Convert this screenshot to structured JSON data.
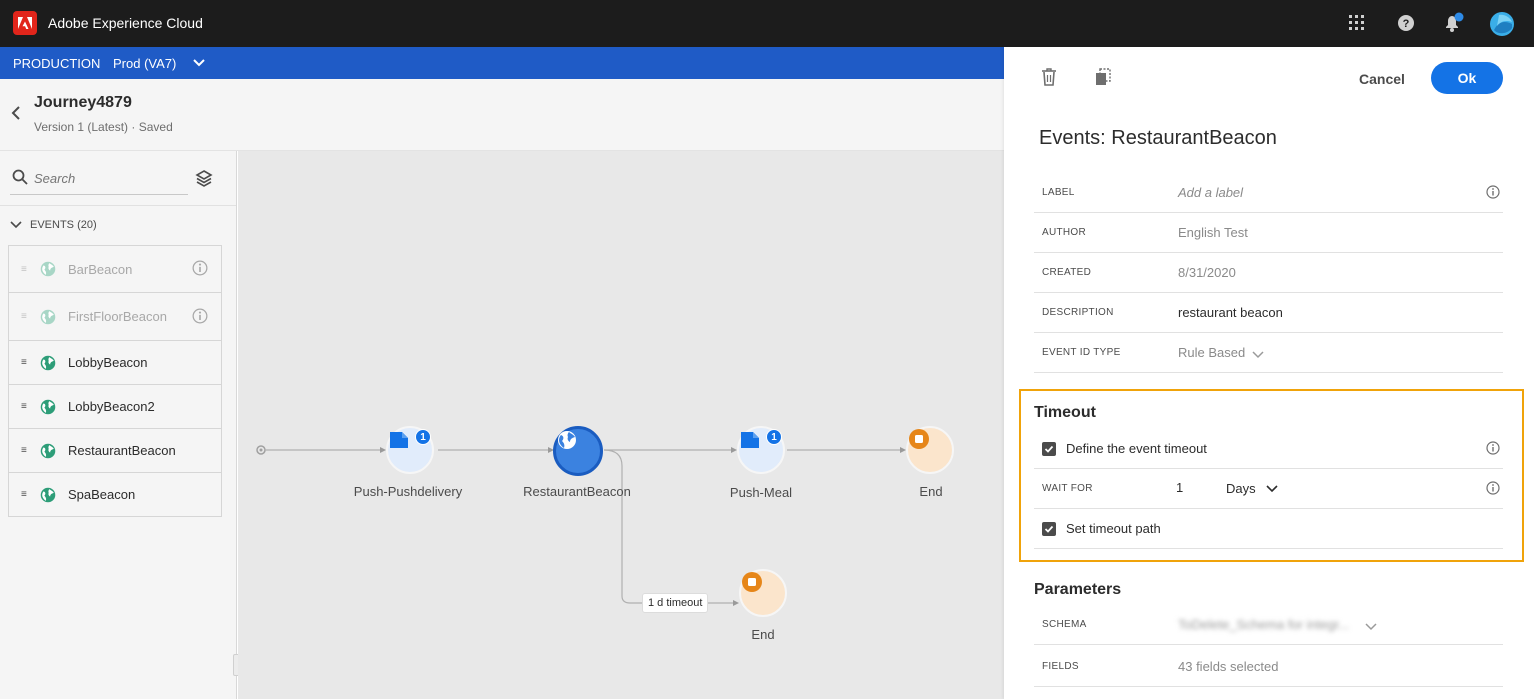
{
  "app": {
    "title": "Adobe Experience Cloud"
  },
  "env": {
    "label": "PRODUCTION",
    "sandbox": "Prod (VA7)"
  },
  "journey": {
    "name": "Journey4879",
    "version": "Version 1 (Latest) · Saved"
  },
  "palette": {
    "search_placeholder": "Search",
    "events_header": "EVENTS (20)",
    "events": [
      {
        "label": "BarBeacon",
        "disabled": true
      },
      {
        "label": "FirstFloorBeacon",
        "disabled": true
      },
      {
        "label": "LobbyBeacon",
        "disabled": false
      },
      {
        "label": "LobbyBeacon2",
        "disabled": false
      },
      {
        "label": "RestaurantBeacon",
        "disabled": false
      },
      {
        "label": "SpaBeacon",
        "disabled": false
      }
    ]
  },
  "canvas": {
    "nodes": [
      {
        "label": "Push-Pushdelivery",
        "badge": "1"
      },
      {
        "label": "RestaurantBeacon"
      },
      {
        "label": "Push-Meal",
        "badge": "1"
      },
      {
        "label": "End"
      },
      {
        "label": "End"
      }
    ],
    "timeout_chip": "1 d timeout"
  },
  "panel": {
    "cancel_label": "Cancel",
    "ok_label": "Ok",
    "title": "Events: RestaurantBeacon",
    "fields": {
      "label_key": "LABEL",
      "label_placeholder": "Add a label",
      "author_key": "AUTHOR",
      "author_val": "English Test",
      "created_key": "CREATED",
      "created_val": "8/31/2020",
      "description_key": "DESCRIPTION",
      "description_val": "restaurant beacon",
      "event_id_type_key": "EVENT ID TYPE",
      "event_id_type_val": "Rule Based"
    },
    "timeout": {
      "title": "Timeout",
      "define_label": "Define the event timeout",
      "define_checked": true,
      "wait_for_key": "WAIT FOR",
      "wait_for_value": "1",
      "wait_for_unit": "Days",
      "set_path_label": "Set timeout path",
      "set_path_checked": true
    },
    "parameters": {
      "title": "Parameters",
      "schema_key": "SCHEMA",
      "schema_val": "ToDelete_Schema for integr...",
      "fields_key": "FIELDS",
      "fields_val": "43 fields selected"
    }
  },
  "colors": {
    "accent": "#1473e6",
    "env_bar": "#1f5bc6",
    "highlight": "#f0a30a",
    "event_green": "#2d9d78",
    "end_orange": "#e68619"
  }
}
